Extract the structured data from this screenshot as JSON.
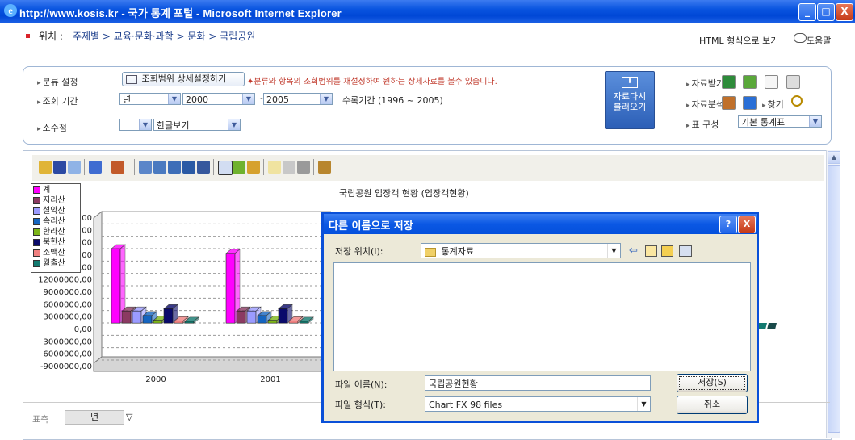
{
  "window": {
    "title": "http://www.kosis.kr - 국가 통계 포털 - Microsoft Internet Explorer",
    "buttons": [
      "_",
      "□",
      "X"
    ]
  },
  "location": {
    "label": "위치 :",
    "breadcrumb": "주제별 > 교육·문화·과학 > 문화 > 국립공원",
    "html_view": "HTML 형식으로 보기",
    "help": "도움말"
  },
  "settings": {
    "category_label": "분류 설정",
    "range_button": "조회범위 상세설정하기",
    "range_hint": "✦분류와 항목의 조회범위를 재설정하여 원하는 상세자료를 볼수 있습니다.",
    "period_label": "조회 기간",
    "period_unit": "년",
    "from_year": "2000",
    "tilde": "~",
    "to_year": "2005",
    "period_range": "수록기간 (1996 ~ 2005)",
    "decimal_label": "소수점",
    "decimal_value": "",
    "view_mode": "한글보기",
    "reload_button": "자료다시 불러오기",
    "download_label": "자료받기",
    "analysis_label": "자료분석",
    "find_label": "찾기",
    "table_label": "표 구성",
    "table_value": "기본 통계표"
  },
  "chart_data": {
    "type": "bar",
    "title": "국립공원 입장객 현황 (입장객현황)",
    "categories": [
      "2000",
      "2001"
    ],
    "series": [
      {
        "name": "계",
        "color": "#ff00ff",
        "values": [
          16000000,
          15000000
        ]
      },
      {
        "name": "지리산",
        "color": "#8b3a62",
        "values": [
          2600000,
          2600000
        ]
      },
      {
        "name": "설악산",
        "color": "#9b9bff",
        "values": [
          2600000,
          2600000
        ]
      },
      {
        "name": "속리산",
        "color": "#1565c0",
        "values": [
          1600000,
          1600000
        ]
      },
      {
        "name": "한라산",
        "color": "#7cb518",
        "values": [
          600000,
          600000
        ]
      },
      {
        "name": "북한산",
        "color": "#0a0a6b",
        "values": [
          3100000,
          3100000
        ]
      },
      {
        "name": "소백산",
        "color": "#f08080",
        "values": [
          500000,
          500000
        ]
      },
      {
        "name": "월출산",
        "color": "#137a70",
        "values": [
          400000,
          400000
        ]
      }
    ],
    "y_ticks": [
      "00",
      "00",
      "00",
      "00",
      "15000000,00",
      "12000000,00",
      "9000000,00",
      "6000000,00",
      "3000000,00",
      "0,00",
      "-3000000,00",
      "-6000000,00",
      "-9000000,00"
    ],
    "ylim": [
      -9000000,
      24000000
    ]
  },
  "footer": {
    "axis_label": "표측",
    "axis_value": "년",
    "axis_arrow": "▽"
  },
  "dialog": {
    "title": "다른 이름으로 저장",
    "help_btn": "?",
    "close_btn": "X",
    "location_label": "저장 위치(I):",
    "location_value": "통계자료",
    "filename_label": "파일 이름(N):",
    "filename_value": "국립공원현황",
    "filetype_label": "파일 형식(T):",
    "filetype_value": "Chart FX 98 files",
    "save_button": "저장(S)",
    "cancel_button": "취소"
  },
  "colors": {
    "xp_blue": "#0a50d8",
    "accent_red": "#d9232a",
    "reload_btn": "#3a6fc4"
  }
}
